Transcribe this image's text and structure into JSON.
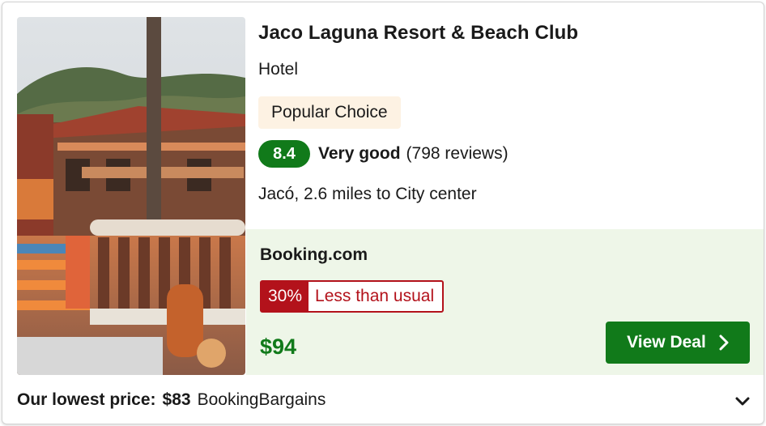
{
  "hotel": {
    "name": "Jaco Laguna Resort & Beach Club",
    "type": "Hotel",
    "badge": "Popular Choice",
    "score": "8.4",
    "rating_word": "Very good",
    "reviews": "(798 reviews)",
    "location": "Jacó, 2.6 miles to City center"
  },
  "deal": {
    "provider": "Booking.com",
    "discount_pct": "30%",
    "discount_text": "Less than usual",
    "price": "$94",
    "button_label": "View Deal"
  },
  "lowest": {
    "label": "Our lowest price:",
    "price": "$83",
    "vendor": "BookingBargains"
  },
  "colors": {
    "accent_green": "#117a1a",
    "discount_red": "#b3121b",
    "deal_bg": "#eef6e8",
    "badge_bg": "#fdf2e3"
  },
  "icons": [
    "hotel-photo",
    "chevron-right-icon",
    "chevron-down-icon"
  ]
}
